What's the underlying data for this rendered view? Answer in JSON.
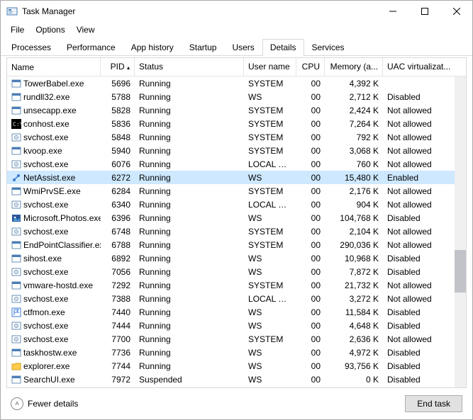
{
  "window": {
    "title": "Task Manager"
  },
  "menu": {
    "file": "File",
    "options": "Options",
    "view": "View"
  },
  "tabs": {
    "processes": "Processes",
    "performance": "Performance",
    "apphistory": "App history",
    "startup": "Startup",
    "users": "Users",
    "details": "Details",
    "services": "Services"
  },
  "columns": {
    "name": "Name",
    "pid": "PID",
    "status": "Status",
    "user": "User name",
    "cpu": "CPU",
    "mem": "Memory (a...",
    "uac": "UAC virtualizat..."
  },
  "footer": {
    "fewer": "Fewer details",
    "endtask": "End task"
  },
  "rows": [
    {
      "name": "TowerBabel.exe",
      "pid": "5696",
      "status": "Running",
      "user": "SYSTEM",
      "cpu": "00",
      "mem": "4,392 K",
      "uac": "",
      "icon": "app"
    },
    {
      "name": "rundll32.exe",
      "pid": "5788",
      "status": "Running",
      "user": "WS",
      "cpu": "00",
      "mem": "2,712 K",
      "uac": "Disabled",
      "icon": "app"
    },
    {
      "name": "unsecapp.exe",
      "pid": "5828",
      "status": "Running",
      "user": "SYSTEM",
      "cpu": "00",
      "mem": "2,424 K",
      "uac": "Not allowed",
      "icon": "app"
    },
    {
      "name": "conhost.exe",
      "pid": "5836",
      "status": "Running",
      "user": "SYSTEM",
      "cpu": "00",
      "mem": "7,264 K",
      "uac": "Not allowed",
      "icon": "console"
    },
    {
      "name": "svchost.exe",
      "pid": "5848",
      "status": "Running",
      "user": "SYSTEM",
      "cpu": "00",
      "mem": "792 K",
      "uac": "Not allowed",
      "icon": "svc"
    },
    {
      "name": "kvoop.exe",
      "pid": "5940",
      "status": "Running",
      "user": "SYSTEM",
      "cpu": "00",
      "mem": "3,068 K",
      "uac": "Not allowed",
      "icon": "app"
    },
    {
      "name": "svchost.exe",
      "pid": "6076",
      "status": "Running",
      "user": "LOCAL SE...",
      "cpu": "00",
      "mem": "760 K",
      "uac": "Not allowed",
      "icon": "svc"
    },
    {
      "name": "NetAssist.exe",
      "pid": "6272",
      "status": "Running",
      "user": "WS",
      "cpu": "00",
      "mem": "15,480 K",
      "uac": "Enabled",
      "icon": "net",
      "selected": true
    },
    {
      "name": "WmiPrvSE.exe",
      "pid": "6284",
      "status": "Running",
      "user": "SYSTEM",
      "cpu": "00",
      "mem": "2,176 K",
      "uac": "Not allowed",
      "icon": "app"
    },
    {
      "name": "svchost.exe",
      "pid": "6340",
      "status": "Running",
      "user": "LOCAL SE...",
      "cpu": "00",
      "mem": "904 K",
      "uac": "Not allowed",
      "icon": "svc"
    },
    {
      "name": "Microsoft.Photos.exe",
      "pid": "6396",
      "status": "Running",
      "user": "WS",
      "cpu": "00",
      "mem": "104,768 K",
      "uac": "Disabled",
      "icon": "photos"
    },
    {
      "name": "svchost.exe",
      "pid": "6748",
      "status": "Running",
      "user": "SYSTEM",
      "cpu": "00",
      "mem": "2,104 K",
      "uac": "Not allowed",
      "icon": "svc"
    },
    {
      "name": "EndPointClassifier.exe",
      "pid": "6788",
      "status": "Running",
      "user": "SYSTEM",
      "cpu": "00",
      "mem": "290,036 K",
      "uac": "Not allowed",
      "icon": "app"
    },
    {
      "name": "sihost.exe",
      "pid": "6892",
      "status": "Running",
      "user": "WS",
      "cpu": "00",
      "mem": "10,968 K",
      "uac": "Disabled",
      "icon": "app"
    },
    {
      "name": "svchost.exe",
      "pid": "7056",
      "status": "Running",
      "user": "WS",
      "cpu": "00",
      "mem": "7,872 K",
      "uac": "Disabled",
      "icon": "svc"
    },
    {
      "name": "vmware-hostd.exe",
      "pid": "7292",
      "status": "Running",
      "user": "SYSTEM",
      "cpu": "00",
      "mem": "21,732 K",
      "uac": "Not allowed",
      "icon": "app"
    },
    {
      "name": "svchost.exe",
      "pid": "7388",
      "status": "Running",
      "user": "LOCAL SE...",
      "cpu": "00",
      "mem": "3,272 K",
      "uac": "Not allowed",
      "icon": "svc"
    },
    {
      "name": "ctfmon.exe",
      "pid": "7440",
      "status": "Running",
      "user": "WS",
      "cpu": "00",
      "mem": "11,584 K",
      "uac": "Disabled",
      "icon": "ctf"
    },
    {
      "name": "svchost.exe",
      "pid": "7444",
      "status": "Running",
      "user": "WS",
      "cpu": "00",
      "mem": "4,648 K",
      "uac": "Disabled",
      "icon": "svc"
    },
    {
      "name": "svchost.exe",
      "pid": "7700",
      "status": "Running",
      "user": "SYSTEM",
      "cpu": "00",
      "mem": "2,636 K",
      "uac": "Not allowed",
      "icon": "svc"
    },
    {
      "name": "taskhostw.exe",
      "pid": "7736",
      "status": "Running",
      "user": "WS",
      "cpu": "00",
      "mem": "4,972 K",
      "uac": "Disabled",
      "icon": "app"
    },
    {
      "name": "explorer.exe",
      "pid": "7744",
      "status": "Running",
      "user": "WS",
      "cpu": "00",
      "mem": "93,756 K",
      "uac": "Disabled",
      "icon": "explorer"
    },
    {
      "name": "SearchUI.exe",
      "pid": "7972",
      "status": "Suspended",
      "user": "WS",
      "cpu": "00",
      "mem": "0 K",
      "uac": "Disabled",
      "icon": "app"
    }
  ]
}
